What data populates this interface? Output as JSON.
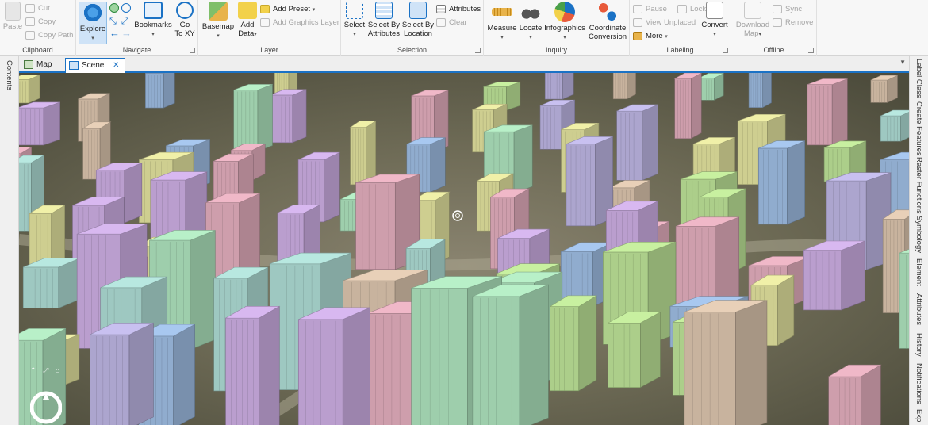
{
  "ribbon": {
    "clipboard": {
      "label": "Clipboard",
      "paste": "Paste",
      "cut": "Cut",
      "copy": "Copy",
      "copy_path": "Copy Path"
    },
    "navigate": {
      "label": "Navigate",
      "explore": "Explore",
      "bookmarks": "Bookmarks",
      "go_to_xy_line1": "Go",
      "go_to_xy_line2": "To XY"
    },
    "layer": {
      "label": "Layer",
      "basemap": "Basemap",
      "add_data_line1": "Add",
      "add_data_line2": "Data",
      "add_preset": "Add Preset",
      "add_graphics_layer": "Add Graphics Layer"
    },
    "selection": {
      "label": "Selection",
      "select": "Select",
      "select_by_attributes_line1": "Select By",
      "select_by_attributes_line2": "Attributes",
      "select_by_location_line1": "Select By",
      "select_by_location_line2": "Location",
      "attributes": "Attributes",
      "clear": "Clear"
    },
    "inquiry": {
      "label": "Inquiry",
      "measure": "Measure",
      "locate": "Locate",
      "infographics": "Infographics",
      "coordinate_conversion_line1": "Coordinate",
      "coordinate_conversion_line2": "Conversion"
    },
    "labeling": {
      "label": "Labeling",
      "pause": "Pause",
      "lock": "Lock",
      "view_unplaced": "View Unplaced",
      "more": "More",
      "convert": "Convert"
    },
    "offline": {
      "label": "Offline",
      "download_map_line1": "Download",
      "download_map_line2": "Map",
      "sync": "Sync",
      "remove": "Remove"
    }
  },
  "left_panel": {
    "contents": "Contents"
  },
  "tabs": [
    {
      "label": "Map",
      "active": false
    },
    {
      "label": "Scene",
      "active": true
    }
  ],
  "right_panel": {
    "items": [
      "Label Class",
      "Create Features",
      "Raster Functions",
      "Symbology",
      "Element",
      "Attributes",
      "History",
      "Notifications",
      "Exp"
    ]
  },
  "colors": {
    "accent": "#1b72c5",
    "active_button_bg": "#cfe3f7"
  }
}
